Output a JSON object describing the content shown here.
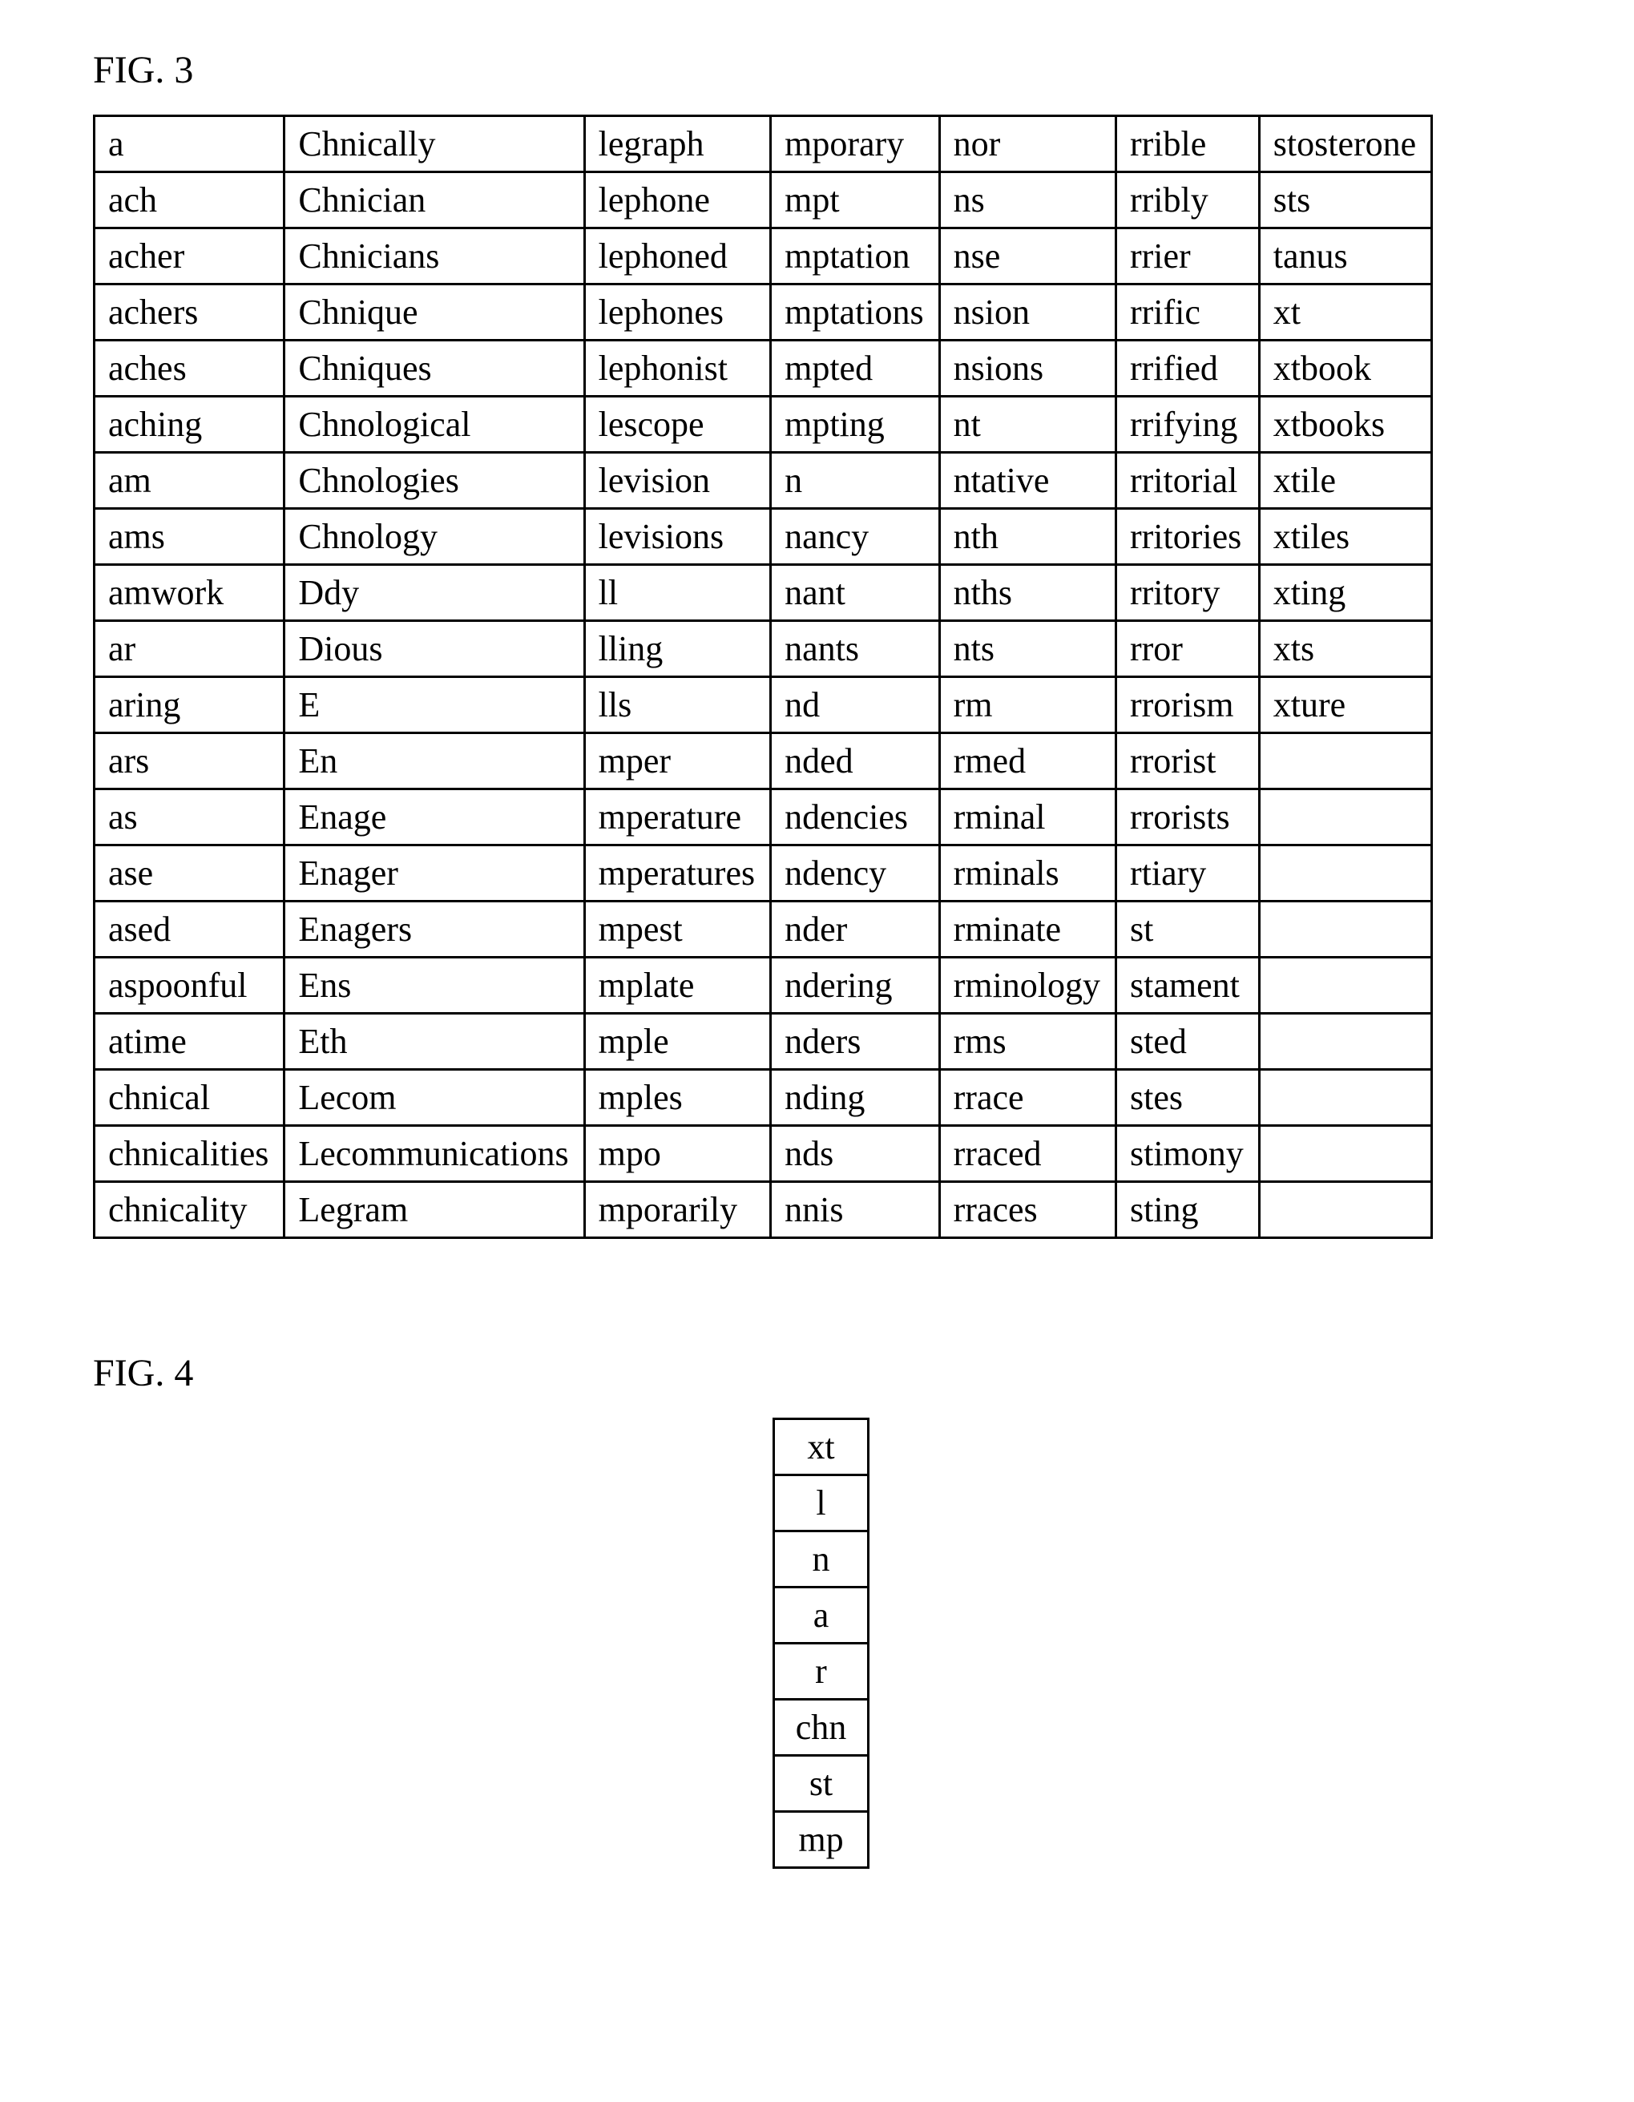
{
  "fig3": {
    "label": "FIG. 3",
    "rows": [
      [
        "a",
        "Chnically",
        "legraph",
        "mporary",
        "nor",
        "rrible",
        "stosterone"
      ],
      [
        "ach",
        "Chnician",
        "lephone",
        "mpt",
        "ns",
        "rribly",
        "sts"
      ],
      [
        "acher",
        "Chnicians",
        "lephoned",
        "mptation",
        "nse",
        "rrier",
        "tanus"
      ],
      [
        "achers",
        "Chnique",
        "lephones",
        "mptations",
        "nsion",
        "rrific",
        "xt"
      ],
      [
        "aches",
        "Chniques",
        "lephonist",
        "mpted",
        "nsions",
        "rrified",
        "xtbook"
      ],
      [
        "aching",
        "Chnological",
        "lescope",
        "mpting",
        "nt",
        "rrifying",
        "xtbooks"
      ],
      [
        "am",
        "Chnologies",
        "levision",
        "n",
        "ntative",
        "rritorial",
        "xtile"
      ],
      [
        "ams",
        "Chnology",
        "levisions",
        "nancy",
        "nth",
        "rritories",
        "xtiles"
      ],
      [
        "amwork",
        "Ddy",
        "ll",
        "nant",
        "nths",
        "rritory",
        "xting"
      ],
      [
        "ar",
        "Dious",
        "lling",
        "nants",
        "nts",
        "rror",
        "xts"
      ],
      [
        "aring",
        "E",
        "lls",
        "nd",
        "rm",
        "rrorism",
        "xture"
      ],
      [
        "ars",
        "En",
        "mper",
        "nded",
        "rmed",
        "rrorist",
        ""
      ],
      [
        "as",
        "Enage",
        "mperature",
        "ndencies",
        "rminal",
        "rrorists",
        ""
      ],
      [
        "ase",
        "Enager",
        "mperatures",
        "ndency",
        "rminals",
        "rtiary",
        ""
      ],
      [
        "ased",
        "Enagers",
        "mpest",
        "nder",
        "rminate",
        "st",
        ""
      ],
      [
        "aspoonful",
        "Ens",
        "mplate",
        "ndering",
        "rminology",
        "stament",
        ""
      ],
      [
        "atime",
        "Eth",
        "mple",
        "nders",
        "rms",
        "sted",
        ""
      ],
      [
        "chnical",
        "Lecom",
        "mples",
        "nding",
        "rrace",
        "stes",
        ""
      ],
      [
        "chnicalities",
        "Lecommunications",
        "mpo",
        "nds",
        "rraced",
        "stimony",
        ""
      ],
      [
        "chnicality",
        "Legram",
        "mporarily",
        "nnis",
        "rraces",
        "sting",
        ""
      ]
    ]
  },
  "fig4": {
    "label": "FIG. 4",
    "cells": [
      "xt",
      "l",
      "n",
      "a",
      "r",
      "chn",
      "st",
      "mp"
    ]
  }
}
